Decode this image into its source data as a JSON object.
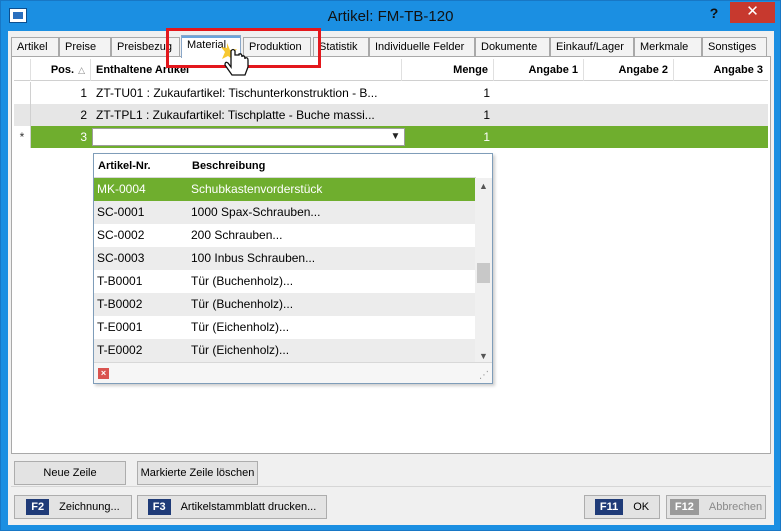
{
  "window": {
    "title": "Artikel: FM-TB-120",
    "help_label": "?",
    "close_label": "✕"
  },
  "tabs": [
    {
      "label": "Artikel"
    },
    {
      "label": "Preise"
    },
    {
      "label": "Preisbezug"
    },
    {
      "label": "Material"
    },
    {
      "label": "Produktion"
    },
    {
      "label": "Statistik"
    },
    {
      "label": "Individuelle Felder"
    },
    {
      "label": "Dokumente"
    },
    {
      "label": "Einkauf/Lager"
    },
    {
      "label": "Merkmale"
    },
    {
      "label": "Sonstiges"
    }
  ],
  "active_tab": "Material",
  "grid": {
    "columns": [
      "Pos.",
      "Enthaltene Artikel",
      "Menge",
      "Angabe 1",
      "Angabe 2",
      "Angabe 3"
    ],
    "rows": [
      {
        "pos": "1",
        "article": "ZT-TU01 : Zukaufartikel: Tischunterkonstruktion - B...",
        "qty": "1"
      },
      {
        "pos": "2",
        "article": "ZT-TPL1 : Zukaufartikel: Tischplatte - Buche massi...",
        "qty": "1"
      }
    ],
    "new_row": {
      "marker": "*",
      "pos": "3",
      "qty": "1"
    }
  },
  "dropdown": {
    "columns": [
      "Artikel-Nr.",
      "Beschreibung"
    ],
    "items": [
      {
        "nr": "MK-0004",
        "desc": "Schubkastenvorderstück"
      },
      {
        "nr": "SC-0001",
        "desc": "1000 Spax-Schrauben..."
      },
      {
        "nr": "SC-0002",
        "desc": "200 Schrauben..."
      },
      {
        "nr": "SC-0003",
        "desc": "100 Inbus Schrauben..."
      },
      {
        "nr": "T-B0001",
        "desc": "Tür (Buchenholz)..."
      },
      {
        "nr": "T-B0002",
        "desc": "Tür (Buchenholz)..."
      },
      {
        "nr": "T-E0001",
        "desc": "Tür (Eichenholz)..."
      },
      {
        "nr": "T-E0002",
        "desc": "Tür (Eichenholz)..."
      }
    ]
  },
  "buttons": {
    "new_row": "Neue Zeile",
    "delete_row": "Markierte Zeile löschen",
    "drawing_key": "F2",
    "drawing": "Zeichnung...",
    "print_key": "F3",
    "print": "Artikelstammblatt drucken...",
    "ok_key": "F11",
    "ok": "OK",
    "cancel_key": "F12",
    "cancel": "Abbrechen"
  },
  "colors": {
    "accent_green": "#6fae2e",
    "title_blue": "#1b8fe2",
    "highlight_red": "#e3171c",
    "fkey_blue": "#1f3b78"
  }
}
